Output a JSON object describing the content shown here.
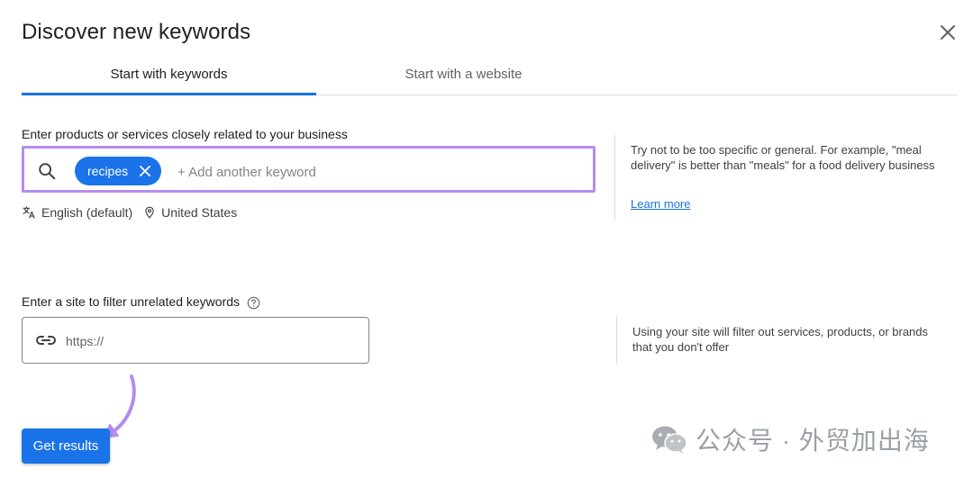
{
  "dialog": {
    "title": "Discover new keywords"
  },
  "tabs": [
    {
      "label": "Start with keywords",
      "active": true
    },
    {
      "label": "Start with a website",
      "active": false
    }
  ],
  "keywords_section": {
    "label": "Enter products or services closely related to your business",
    "chips": [
      "recipes"
    ],
    "input_placeholder": "+ Add another keyword",
    "language": "English (default)",
    "location": "United States",
    "help_text": "Try not to be too specific or general. For example, \"meal delivery\" is better than \"meals\" for a food delivery business",
    "learn_more": "Learn more"
  },
  "site_section": {
    "label": "Enter a site to filter unrelated keywords",
    "input_placeholder": "https://",
    "help_text": "Using your site will filter out services, products, or brands that you don't offer"
  },
  "actions": {
    "get_results_label": "Get results"
  },
  "watermark": {
    "text": "公众号 · 外贸加出海"
  },
  "colors": {
    "primary": "#1a73e8",
    "highlight": "#b48cf2",
    "annotation_arrow": "#b48cf2"
  },
  "icons": [
    "close-icon",
    "search-icon",
    "chip-remove-icon",
    "translate-icon",
    "location-pin-icon",
    "help-circle-icon",
    "link-icon",
    "wechat-icon"
  ]
}
